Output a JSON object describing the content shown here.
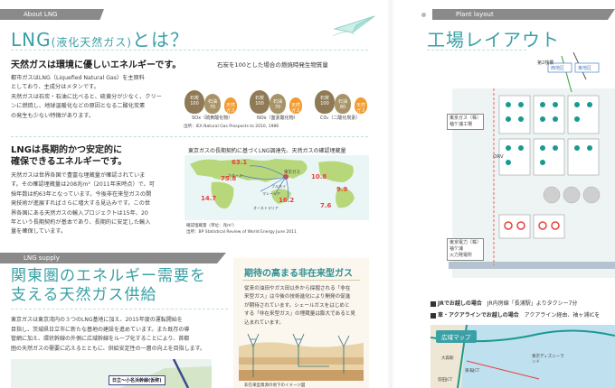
{
  "left": {
    "about_tag": "About LNG",
    "title_main": "LNG",
    "title_paren": "(液化天然ガス)",
    "title_end": "とは？",
    "section1": {
      "heading": "天然ガスは環境に優しいエネルギーです。",
      "lines": [
        "都市ガスはLNG（Liquefied Natural Gas）を主原料",
        "としており、主成分はメタンです。",
        "天然ガスは石炭・石油に比べると、硫黄分が少なく、クリー",
        "ンに燃焼し、地球温暖化などの原因となる二酸化炭素",
        "の発生も少ない特徴があります。"
      ]
    },
    "emissions_chart": {
      "title": "石炭を100とした場合の燃焼時発生物質量",
      "groups": [
        {
          "label": "SOx（硫黄酸化物）",
          "bags": [
            {
              "name": "石炭",
              "value": "100",
              "color": "#8f7a55"
            },
            {
              "name": "石油",
              "value": "70",
              "color": "#a89368"
            },
            {
              "name": "天然ガス",
              "value": "0",
              "color": "#f29a2e"
            }
          ]
        },
        {
          "label": "NOx（窒素酸化物）",
          "bags": [
            {
              "name": "石炭",
              "value": "100",
              "color": "#8f7a55"
            },
            {
              "name": "石油",
              "value": "70",
              "color": "#a89368"
            },
            {
              "name": "天然ガス",
              "value": "20～40",
              "color": "#f29a2e"
            }
          ]
        },
        {
          "label": "CO₂（二酸化炭素）",
          "bags": [
            {
              "name": "石炭",
              "value": "100",
              "color": "#8f7a55"
            },
            {
              "name": "石油",
              "value": "80",
              "color": "#a89368"
            },
            {
              "name": "天然ガス",
              "value": "60",
              "color": "#f29a2e"
            }
          ]
        }
      ],
      "source": "出所：IEA Natural Gas Prospects to 2010, 1986"
    },
    "section2": {
      "heading_lines": [
        "LNGは長期的かつ安定的に",
        "確保できるエネルギーです。"
      ],
      "lines": [
        "天然ガスは世界各国で豊富な埋蔵量が確認されていま",
        "す。その確認埋蔵量は208兆m³（2011年末時点）で、可",
        "採年数は約63年となっています。今後非在来型ガスの開",
        "発技術が進展すればさらに増大する見込みです。この世",
        "界各国にある天然ガスの輸入プロジェクトは15年、20",
        "年という長期契約が基本であり、長期的に安定した輸入",
        "量を確保しています。"
      ]
    },
    "world_map": {
      "title": "東京ガスの長期契約に基づくLNG調達先、天然ガスの確認埋蔵量",
      "values": [
        {
          "region": "旧ソ連",
          "value": "63.1"
        },
        {
          "region": "中東",
          "value": "75.8"
        },
        {
          "region": "アフリカ",
          "value": "14.7"
        },
        {
          "region": "アジア・オセアニア",
          "value": "16.2"
        },
        {
          "region": "北米",
          "value": "10.8"
        },
        {
          "region": "中南米",
          "value": "7.6"
        },
        {
          "region": "",
          "value": "9.9"
        }
      ],
      "labels": [
        "東京ガス",
        "マレーシア",
        "ブルネイ",
        "オーストラリア",
        "カタール"
      ],
      "note": "確認埋蔵量（単位：兆m³）",
      "source": "出所：BP Statistical Review of World Energy June 2011"
    },
    "supply_tag": "LNG supply",
    "supply_title_lines": [
      "関東圏のエネルギー需要を",
      "支える天然ガス供給"
    ],
    "supply_lines": [
      "東京ガスは東京湾内の３つのLNG基地に加え、2015年度の運転開始を",
      "目指し、茨城県日立市に新たな基地の建設を進めています。また既存の導",
      "管網に加え、環状幹線の外側に広域幹線をループ化することにより、首都",
      "圏の天然ガスの需要に応えるとともに、供給安定性の一層の向上を目指します。"
    ],
    "pipeline_label": "日立～小名浜幹線(仮称)"
  },
  "box": {
    "title": "期待の高まる非在来型ガス",
    "lines": [
      "従来の油田やガス田以外から採掘される「非在",
      "来型ガス」は今後の技術進化により開発の促進",
      "が期待されています。シェールガスをはじめと",
      "する「非在来型ガス」の埋蔵量は膨大であると見",
      "込まれています。"
    ],
    "foot": "非在来型資源の地下のイメージ図"
  },
  "right": {
    "tag": "Plant layout",
    "title": "工場レイアウト",
    "labels": {
      "berth": "第2桟橋",
      "west": "西地区",
      "east": "東地区",
      "tokyo_gas_facility": [
        "東京ガス（株）",
        "袖ケ浦工場"
      ],
      "orv": "ORV",
      "tepco": [
        "東京電力（株）",
        "袖ケ浦",
        "火力発電所"
      ]
    },
    "access": {
      "rail_label": "JRでお越しの場合",
      "rail_text": "JR内房線「長浦駅」よりタクシー7分",
      "car_label": "車・アクアラインでお越しの場合",
      "car_text": "アクアライン経由、袖ヶ浦ICを",
      "map_label": "広域マップ",
      "place1": "大森駅",
      "place2": "東京ディズニーランド",
      "place3": "羽田JCT",
      "place4": "東海JCT"
    }
  },
  "colors": {
    "teal": "#3aa0a5",
    "gray_tag": "#8a8a8a",
    "box_bg": "#fbf6ee",
    "red": "#e4433c"
  }
}
